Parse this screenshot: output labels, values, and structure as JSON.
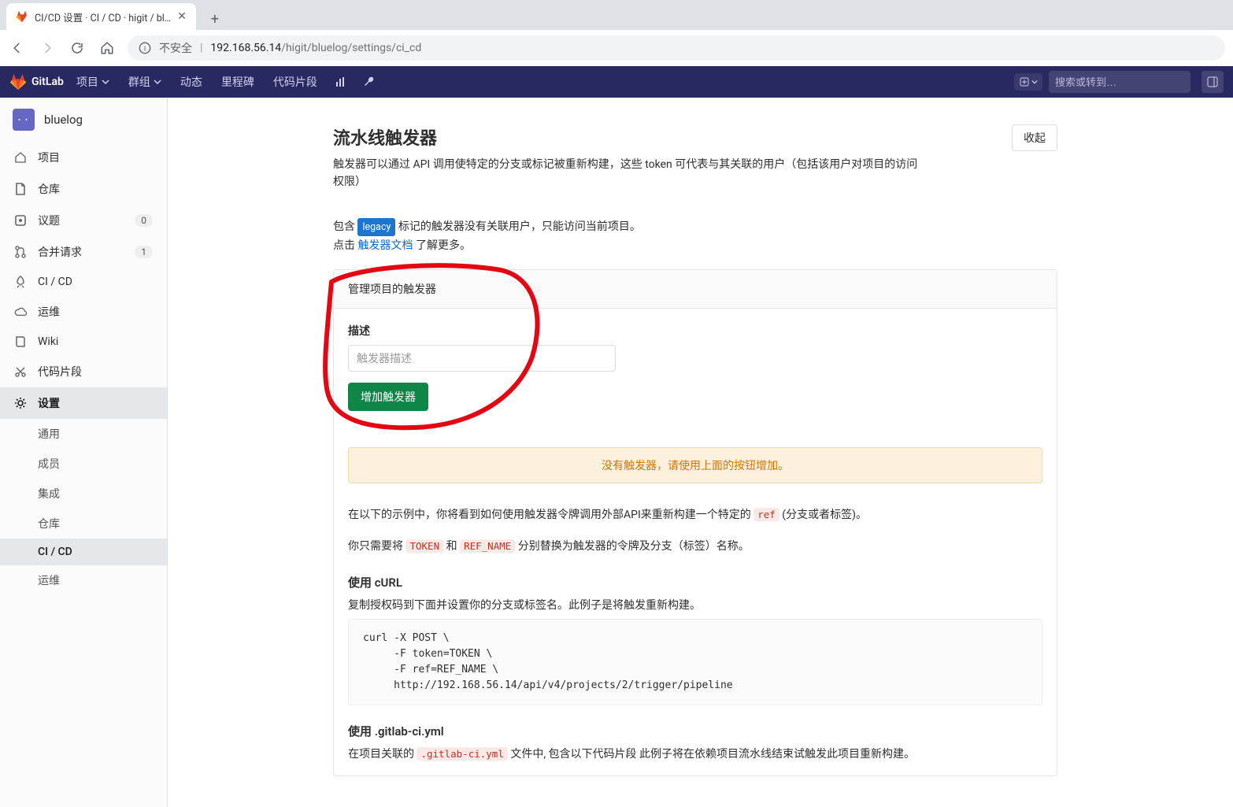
{
  "browser": {
    "tab_title": "CI/CD 设置 · CI / CD · higit / bl…",
    "insecure_label": "不安全",
    "url_host": "192.168.56.14",
    "url_path": "/higit/bluelog/settings/ci_cd"
  },
  "topnav": {
    "brand": "GitLab",
    "items": [
      "项目",
      "群组",
      "动态",
      "里程碑",
      "代码片段"
    ],
    "search_placeholder": "搜索或转到…"
  },
  "sidebar": {
    "project_name": "bluelog",
    "avatar_dots": "• •",
    "items": [
      {
        "icon": "home",
        "label": "项目"
      },
      {
        "icon": "file",
        "label": "仓库"
      },
      {
        "icon": "issues",
        "label": "议题",
        "badge": "0"
      },
      {
        "icon": "merge",
        "label": "合并请求",
        "badge": "1"
      },
      {
        "icon": "rocket",
        "label": "CI / CD"
      },
      {
        "icon": "cloud",
        "label": "运维"
      },
      {
        "icon": "book",
        "label": "Wiki"
      },
      {
        "icon": "scissors",
        "label": "代码片段"
      },
      {
        "icon": "gear",
        "label": "设置",
        "active": true
      }
    ],
    "settings_sub": [
      "通用",
      "成员",
      "集成",
      "仓库",
      "CI / CD",
      "运维"
    ],
    "settings_sub_current": "CI / CD"
  },
  "content": {
    "section_title": "流水线触发器",
    "section_desc": "触发器可以通过 API 调用使特定的分支或标记被重新构建，这些 token 可代表与其关联的用户（包括该用户对项目的访问权限）",
    "collapse_btn": "收起",
    "legacy_para_prefix": "包含 ",
    "legacy_tag": "legacy",
    "legacy_para_suffix": " 标记的触发器没有关联用户，只能访问当前项目。",
    "click_prefix": "点击 ",
    "doc_link": "触发器文档",
    "click_suffix": " 了解更多。",
    "panel_head": "管理项目的触发器",
    "form_label": "描述",
    "input_placeholder": "触发器描述",
    "add_btn": "增加触发器",
    "alert_text": "没有触发器，请使用上面的按钮增加。",
    "example_para1_a": "在以下的示例中，你将看到如何使用触发器令牌调用外部API来重新构建一个特定的 ",
    "example_para1_code": "ref",
    "example_para1_b": " (分支或者标签)。",
    "example_para2_a": "你只需要将 ",
    "example_para2_code1": "TOKEN",
    "example_para2_mid": " 和 ",
    "example_para2_code2": "REF_NAME",
    "example_para2_b": " 分别替换为触发器的令牌及分支（标签）名称。",
    "h4_curl": "使用 cURL",
    "curl_desc": "复制授权码到下面并设置你的分支或标签名。此例子是将触发重新构建。",
    "code_block": "curl -X POST \\\n     -F token=TOKEN \\\n     -F ref=REF_NAME \\\n     http://192.168.56.14/api/v4/projects/2/trigger/pipeline",
    "h4_yml": "使用 .gitlab-ci.yml",
    "yml_desc_a": "在项目关联的 ",
    "yml_desc_code": ".gitlab-ci.yml",
    "yml_desc_b": " 文件中, 包含以下代码片段 此例子将在依赖项目流水线结束试触发此项目重新构建。"
  }
}
